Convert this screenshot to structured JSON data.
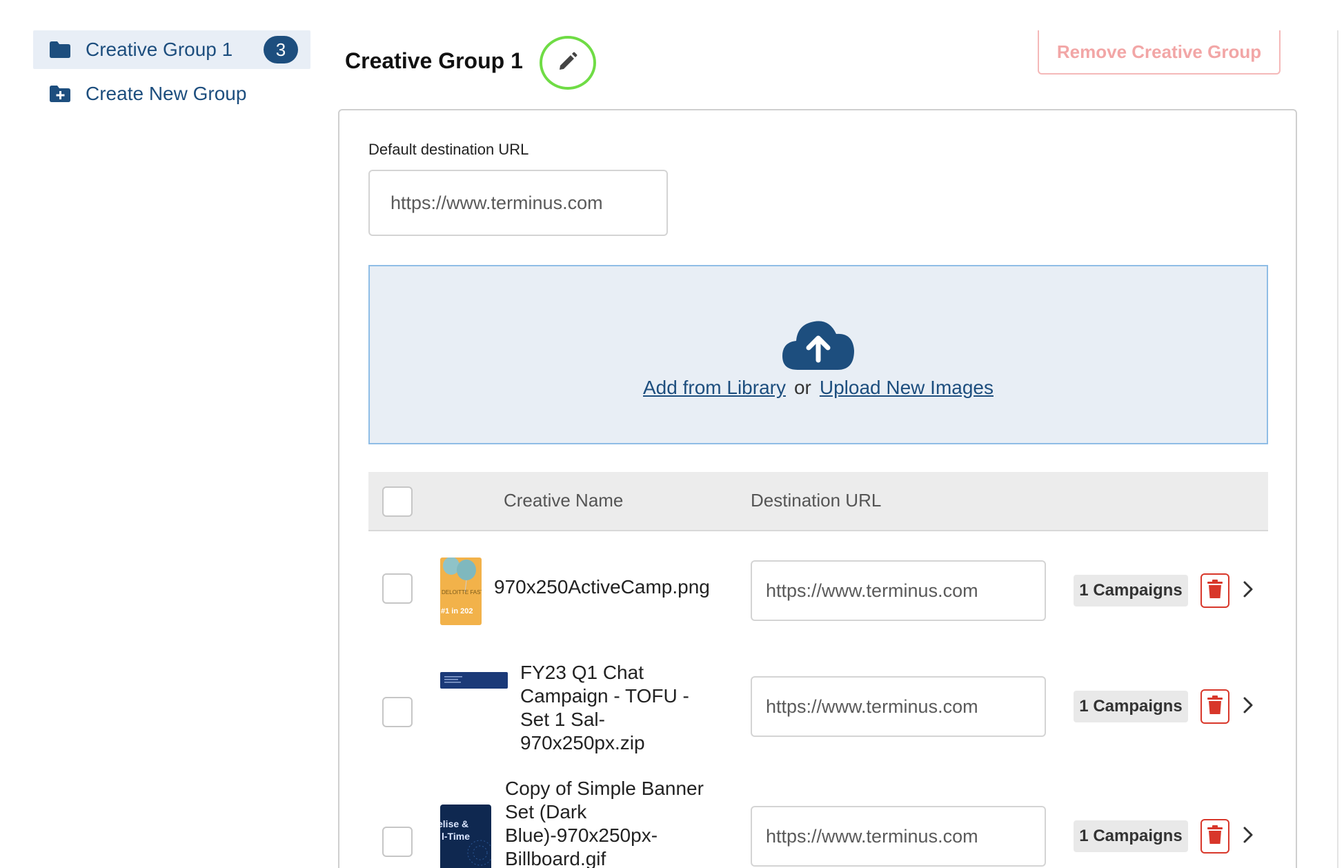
{
  "sidebar": {
    "items": [
      {
        "label": "Creative Group 1",
        "badge": "3",
        "icon": "folder-icon",
        "active": true
      },
      {
        "label": "Create New Group",
        "icon": "folder-plus-icon",
        "active": false
      }
    ]
  },
  "header": {
    "title": "Creative Group 1",
    "edit_icon": "pencil-icon",
    "remove_label": "Remove Creative Group"
  },
  "form": {
    "default_url_label": "Default destination URL",
    "default_url_placeholder": "https://www.terminus.com"
  },
  "dropzone": {
    "icon": "cloud-upload-icon",
    "add_library": "Add from Library",
    "or": "or",
    "upload": "Upload New Images"
  },
  "table": {
    "headers": {
      "name": "Creative Name",
      "url": "Destination URL"
    },
    "rows": [
      {
        "name": "970x250ActiveCamp.png",
        "url_placeholder": "https://www.terminus.com",
        "campaigns": "1 Campaigns",
        "thumb_text": [
          "DELOITTE FAST",
          "#1 in 202"
        ]
      },
      {
        "name": "FY23 Q1 Chat Campaign - TOFU - Set 1 Sal-970x250px.zip",
        "url_placeholder": "https://www.terminus.com",
        "campaigns": "1 Campaigns"
      },
      {
        "name": "Copy of Simple Banner Set (Dark Blue)-970x250px-Billboard.gif",
        "url_placeholder": "https://www.terminus.com",
        "campaigns": "1 Campaigns",
        "thumb_text": [
          "elise &",
          "l-Time"
        ]
      }
    ]
  },
  "colors": {
    "brand": "#1d4e7e",
    "danger": "#d8372a",
    "edit_ring": "#6fdc45",
    "dropzone_bg": "#e8eef5"
  }
}
